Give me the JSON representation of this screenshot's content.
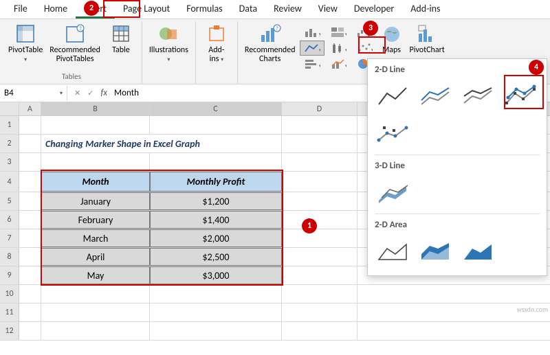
{
  "ribbon": {
    "tabs": [
      "File",
      "Home",
      "Insert",
      "Page Layout",
      "Formulas",
      "Data",
      "Review",
      "View",
      "Developer",
      "Add-ins"
    ],
    "active_tab": "Insert",
    "groups": {
      "tables_label": "Tables",
      "pivot_table": "PivotTable",
      "rec_pivot": "Recommended\nPivotTables",
      "table": "Table",
      "illustrations": "Illustrations",
      "addins": "Add-\nins",
      "rec_charts": "Recommended\nCharts",
      "maps": "Maps",
      "pivotchart": "PivotChart"
    }
  },
  "formula_bar": {
    "namebox": "B4",
    "fx": "fx",
    "value": "Month"
  },
  "sheet": {
    "title": "Changing Marker Shape in Excel Graph",
    "headers": {
      "month": "Month",
      "profit": "Monthly Profit"
    },
    "rows": [
      {
        "month": "January",
        "profit": "$1,200"
      },
      {
        "month": "February",
        "profit": "$1,400"
      },
      {
        "month": "March",
        "profit": "$2,000"
      },
      {
        "month": "April",
        "profit": "$2,500"
      },
      {
        "month": "May",
        "profit": "$3,000"
      }
    ]
  },
  "chart_panel": {
    "sec1": "2-D Line",
    "sec2": "3-D Line",
    "sec3": "2-D Area"
  },
  "column_widths": {
    "corner": 28,
    "A": 32,
    "B": 158,
    "C": 192,
    "D": 110
  },
  "annotations": {
    "m1": "1",
    "m2": "2",
    "m3": "3",
    "m4": "4"
  },
  "watermark": "wsxdn.com"
}
